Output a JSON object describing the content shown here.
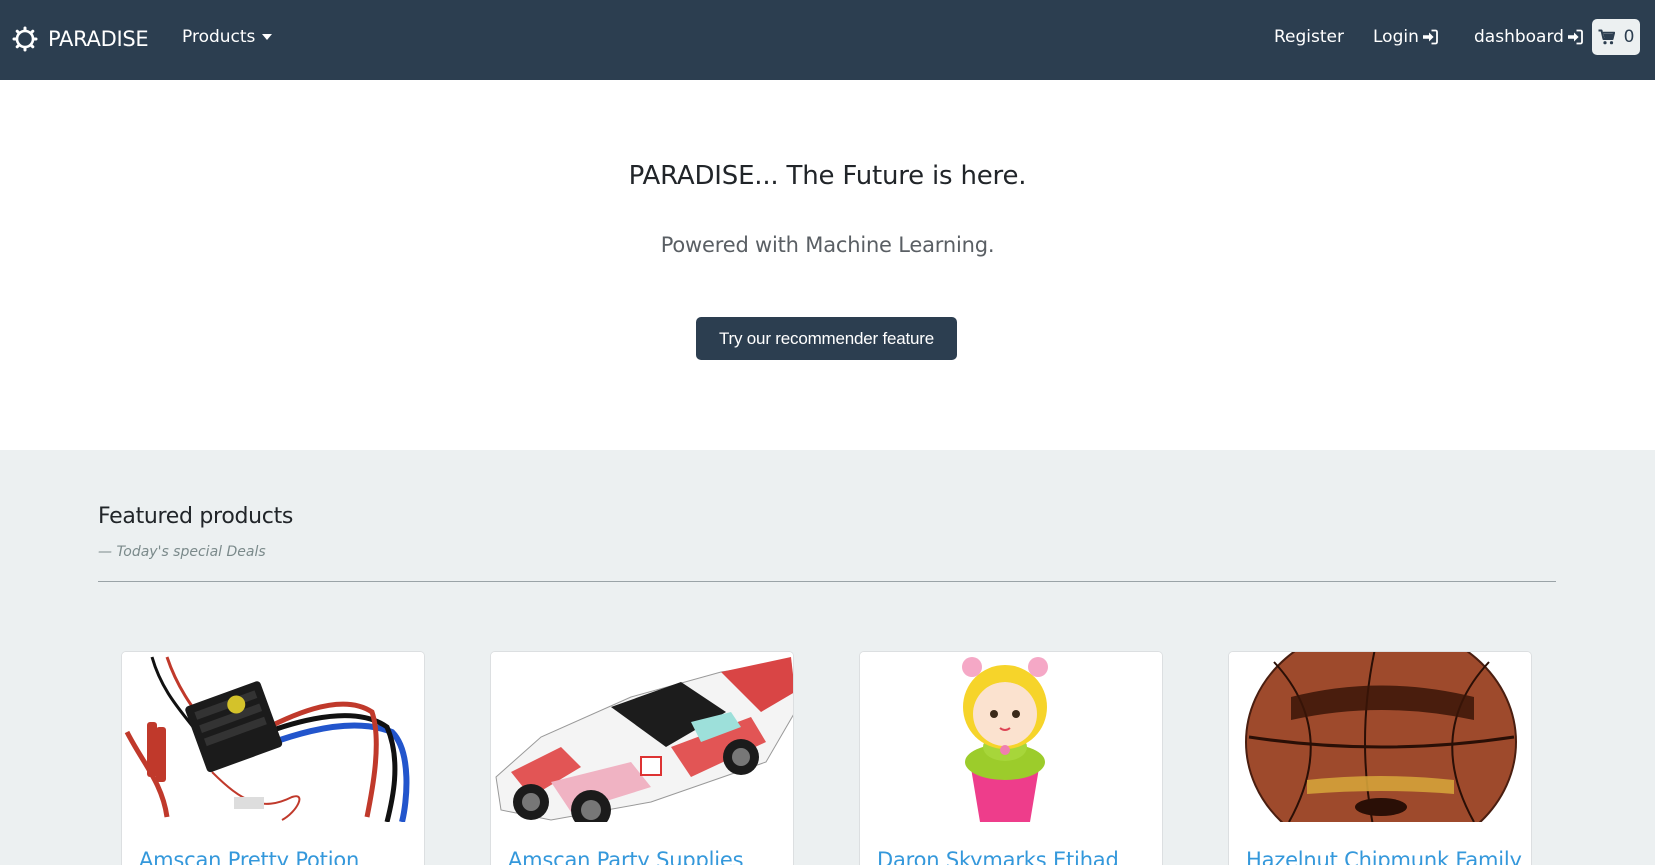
{
  "navbar": {
    "brand": "PARADISE",
    "brand_icon": "gear-icon",
    "products_label": "Products",
    "register_label": "Register",
    "login_label": "Login",
    "dashboard_label": "dashboard",
    "login_icon": "sign-in-icon",
    "cart_icon": "shopping-cart-icon",
    "cart_count": "0",
    "background_color": "#2c3e50"
  },
  "hero": {
    "title": "PARADISE... The Future is here.",
    "subtitle": "Powered with Machine Learning.",
    "button_label": "Try our recommender feature"
  },
  "featured": {
    "title": "Featured products",
    "subtitle": "— Today's special Deals",
    "background_color": "#ecf0f1",
    "products": [
      {
        "name": "Amscan Pretty Potion",
        "image": "electronic speed controller with wires"
      },
      {
        "name": "Amscan Party Supplies",
        "image": "racing car model"
      },
      {
        "name": "Daron Skymarks Etihad",
        "image": "doll figure"
      },
      {
        "name": "Hazelnut Chipmunk Family",
        "image": "basketball"
      }
    ]
  }
}
